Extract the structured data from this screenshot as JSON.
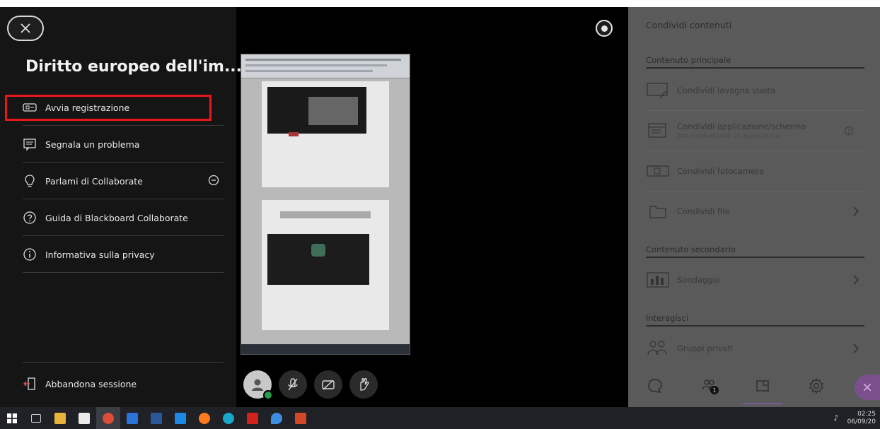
{
  "session": {
    "title": "Diritto europeo dell'im..."
  },
  "menu": {
    "items": [
      {
        "label": "Avvia registrazione",
        "icon": "record-icon"
      },
      {
        "label": "Segnala un problema",
        "icon": "report-problem-icon"
      },
      {
        "label": "Parlami di Collaborate",
        "icon": "lightbulb-icon"
      },
      {
        "label": "Guida di Blackboard Collaborate",
        "icon": "help-icon"
      },
      {
        "label": "Informativa sulla privacy",
        "icon": "info-icon"
      }
    ],
    "leave_label": "Abbandona sessione"
  },
  "share_panel": {
    "title": "Condividi contenuti",
    "primary_section": "Contenuto principale",
    "secondary_section": "Contenuto secondario",
    "interact_section": "Interagisci",
    "items": {
      "whiteboard": "Condividi lavagna vuota",
      "application": "Condividi applicazione/schermo",
      "application_sub": "Stai condividendo un'applicazione",
      "camera": "Condividi fotocamera",
      "file": "Condividi file",
      "poll": "Sondaggio",
      "groups": "Gruppi privati"
    },
    "participants_count": "1"
  },
  "tray": {
    "time": "02:25",
    "date": "06/09/20"
  },
  "colors": {
    "highlight": "#e8171b",
    "accent": "#7a4f8c",
    "status_online": "#2a9d4a"
  }
}
